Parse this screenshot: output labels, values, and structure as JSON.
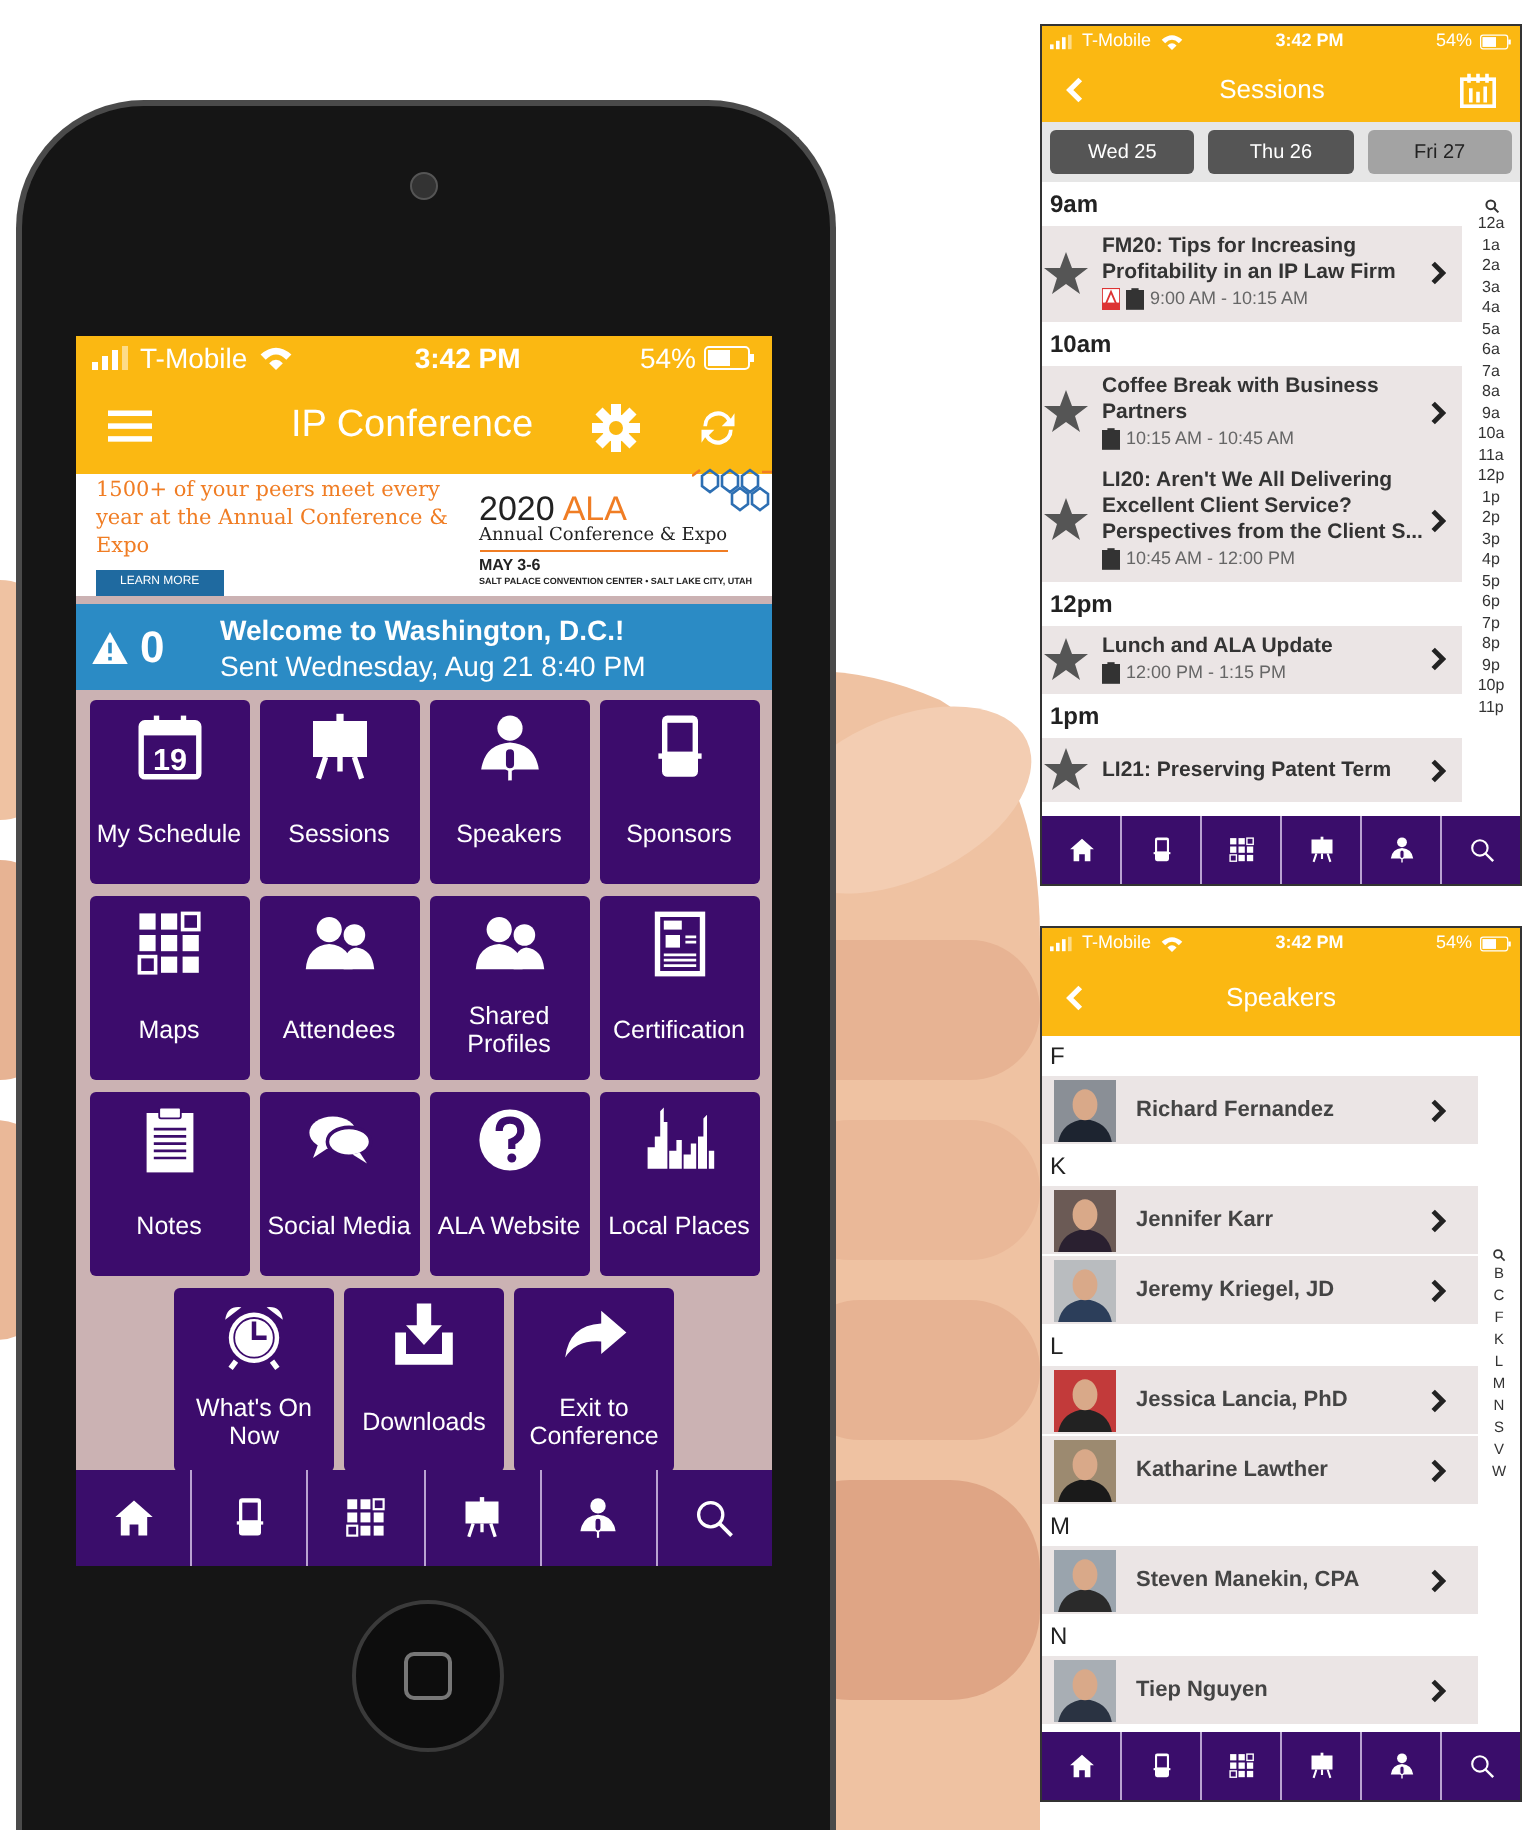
{
  "phone": {
    "status_bar": {
      "carrier": "T-Mobile",
      "time": "3:42 PM",
      "battery": "54%"
    },
    "header": {
      "title": "IP Conference"
    },
    "banner": {
      "headline": "1500+ of your peers meet every year at the Annual Conference & Expo",
      "button": "LEARN MORE",
      "logo_year": "2020",
      "logo_org": "ALA",
      "logo_subtitle": "Annual Conference & Expo",
      "logo_dates": "MAY 3-6",
      "logo_venue": "SALT PALACE CONVENTION CENTER  •  SALT LAKE CITY, UTAH"
    },
    "alert": {
      "count": "0",
      "title": "Welcome to Washington, D.C.!",
      "subtitle": "Sent Wednesday, Aug 21 8:40 PM"
    },
    "tiles": [
      {
        "label": "My Schedule",
        "kind": "calendar",
        "icon_text": "19"
      },
      {
        "label": "Sessions",
        "kind": "easel"
      },
      {
        "label": "Speakers",
        "kind": "speaker"
      },
      {
        "label": "Sponsors",
        "kind": "booth"
      },
      {
        "label": "Maps",
        "kind": "map"
      },
      {
        "label": "Attendees",
        "kind": "people"
      },
      {
        "label": "Shared Profiles",
        "kind": "people"
      },
      {
        "label": "Certification",
        "kind": "certificate"
      },
      {
        "label": "Notes",
        "kind": "notes"
      },
      {
        "label": "Social Media",
        "kind": "chat"
      },
      {
        "label": "ALA Website",
        "kind": "help"
      },
      {
        "label": "Local Places",
        "kind": "city"
      },
      {
        "label": "What's On Now",
        "kind": "alarm"
      },
      {
        "label": "Downloads",
        "kind": "download"
      },
      {
        "label": "Exit to Conference",
        "kind": "share"
      }
    ],
    "tab_bar": [
      {
        "kind": "home"
      },
      {
        "kind": "booth"
      },
      {
        "kind": "map"
      },
      {
        "kind": "easel"
      },
      {
        "kind": "speaker"
      },
      {
        "kind": "search"
      }
    ]
  },
  "sessions_screen": {
    "status_bar": {
      "carrier": "T-Mobile",
      "time": "3:42 PM",
      "battery": "54%"
    },
    "title": "Sessions",
    "day_tabs": [
      {
        "label": "Wed 25",
        "selected": false
      },
      {
        "label": "Thu 26",
        "selected": false
      },
      {
        "label": "Fri 27",
        "selected": true
      }
    ],
    "groups": [
      {
        "time": "9am",
        "items": [
          {
            "title": "FM20: Tips for Increasing Profitability in an IP Law Firm",
            "time": "9:00 AM - 10:15 AM",
            "has_pdf": true
          }
        ]
      },
      {
        "time": "10am",
        "items": [
          {
            "title": "Coffee Break with Business Partners",
            "time": "10:15 AM - 10:45 AM",
            "has_pdf": false
          },
          {
            "title": "LI20: Aren't We All Delivering Excellent Client Service? Perspectives from the Client S...",
            "time": "10:45 AM - 12:00 PM",
            "has_pdf": false
          }
        ]
      },
      {
        "time": "12pm",
        "items": [
          {
            "title": "Lunch and ALA Update",
            "time": "12:00 PM - 1:15 PM",
            "has_pdf": false
          }
        ]
      },
      {
        "time": "1pm",
        "items": [
          {
            "title": "LI21: Preserving Patent Term"
          }
        ]
      }
    ],
    "hour_index": [
      "12a",
      "1a",
      "2a",
      "3a",
      "4a",
      "5a",
      "6a",
      "7a",
      "8a",
      "9a",
      "10a",
      "11a",
      "12p",
      "1p",
      "2p",
      "3p",
      "4p",
      "5p",
      "6p",
      "7p",
      "8p",
      "9p",
      "10p",
      "11p"
    ],
    "tab_bar": [
      {
        "kind": "home"
      },
      {
        "kind": "booth"
      },
      {
        "kind": "map"
      },
      {
        "kind": "easel"
      },
      {
        "kind": "speaker"
      },
      {
        "kind": "search"
      }
    ]
  },
  "speakers_screen": {
    "status_bar": {
      "carrier": "T-Mobile",
      "time": "3:42 PM",
      "battery": "54%"
    },
    "title": "Speakers",
    "sections": [
      {
        "letter": "F",
        "speakers": [
          "Richard Fernandez"
        ]
      },
      {
        "letter": "K",
        "speakers": [
          "Jennifer Karr",
          "Jeremy Kriegel, JD"
        ]
      },
      {
        "letter": "L",
        "speakers": [
          "Jessica Lancia, PhD",
          "Katharine Lawther"
        ]
      },
      {
        "letter": "M",
        "speakers": [
          "Steven Manekin, CPA"
        ]
      },
      {
        "letter": "N",
        "speakers": [
          "Tiep Nguyen"
        ]
      }
    ],
    "letter_index": [
      "B",
      "C",
      "F",
      "K",
      "L",
      "M",
      "N",
      "S",
      "V",
      "W"
    ],
    "tab_bar": [
      {
        "kind": "home"
      },
      {
        "kind": "booth"
      },
      {
        "kind": "map"
      },
      {
        "kind": "easel"
      },
      {
        "kind": "speaker"
      },
      {
        "kind": "search"
      }
    ]
  }
}
